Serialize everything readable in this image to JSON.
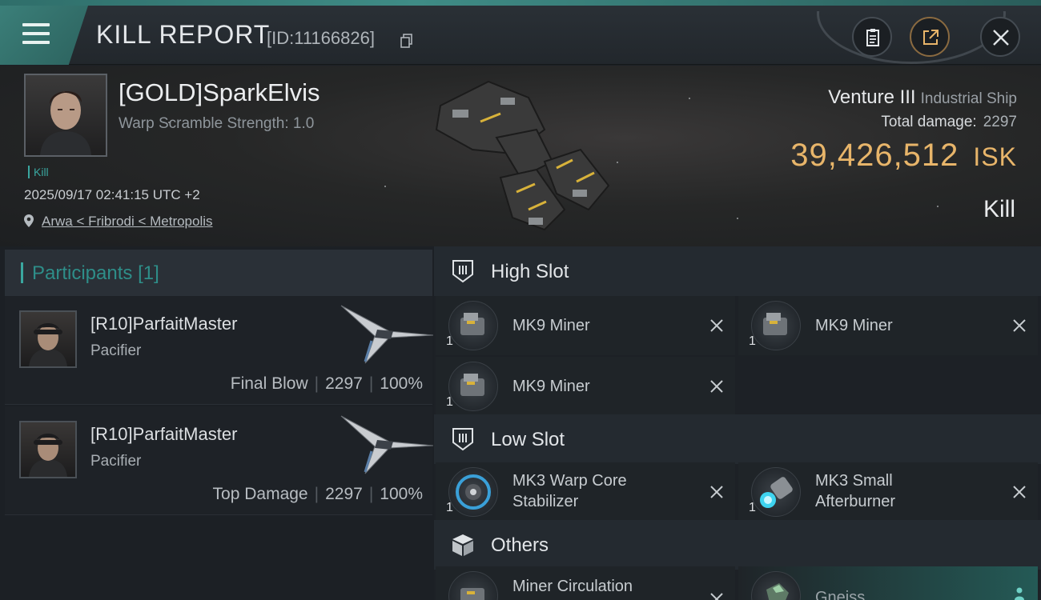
{
  "header": {
    "title": "KILL REPORT",
    "report_id": "[ID:11166826]"
  },
  "victim": {
    "name": "[GOLD]SparkElvis",
    "warp_scramble": "Warp Scramble Strength: 1.0",
    "tag": "Kill",
    "timestamp": "2025/09/17 02:41:15 UTC +2",
    "location": "Arwa < Fribrodi < Metropolis",
    "ship_name": "Venture III",
    "ship_class": "Industrial Ship",
    "total_damage_label": "Total damage:",
    "total_damage": "2297",
    "isk_value": "39,426,512",
    "isk_unit": "ISK",
    "result": "Kill"
  },
  "participants": {
    "label": "Participants",
    "count": "[1]",
    "rows": [
      {
        "name": "[R10]ParfaitMaster",
        "ship": "Pacifier",
        "role": "Final Blow",
        "damage": "2297",
        "percent": "100%"
      },
      {
        "name": "[R10]ParfaitMaster",
        "ship": "Pacifier",
        "role": "Top Damage",
        "damage": "2297",
        "percent": "100%"
      }
    ]
  },
  "fittings": {
    "high_slot": {
      "label": "High Slot",
      "items": [
        {
          "name": "MK9 Miner",
          "qty": "1"
        },
        {
          "name": "MK9 Miner",
          "qty": "1"
        },
        {
          "name": "MK9 Miner",
          "qty": "1"
        }
      ]
    },
    "low_slot": {
      "label": "Low Slot",
      "items": [
        {
          "name_line1": "MK3 Warp Core",
          "name_line2": "Stabilizer",
          "qty": "1"
        },
        {
          "name_line1": "MK3 Small",
          "name_line2": "Afterburner",
          "qty": "1"
        }
      ]
    },
    "others": {
      "label": "Others",
      "items": [
        {
          "name": "Miner Circulation"
        },
        {
          "name": "Gneiss"
        }
      ]
    }
  },
  "colors": {
    "accent": "#3aa7a0",
    "isk": "#e8b56a",
    "header_teal": "#3b7f79"
  }
}
